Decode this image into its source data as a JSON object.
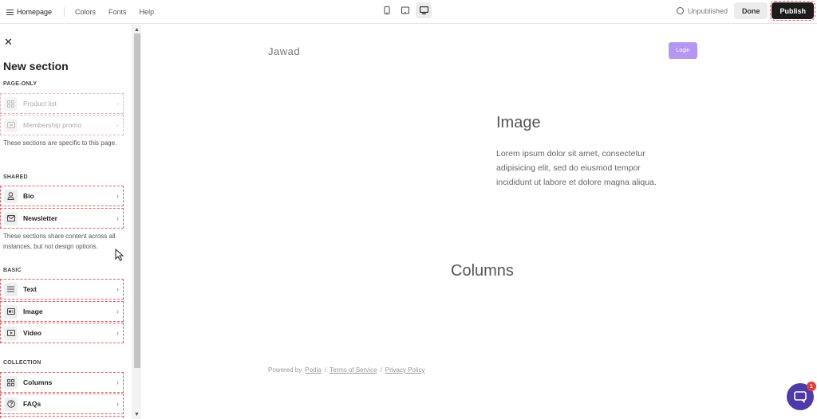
{
  "topbar": {
    "home_label": "Homepage",
    "nav": [
      "Colors",
      "Fonts",
      "Help"
    ],
    "status": "Unpublished",
    "done_label": "Done",
    "publish_label": "Publish"
  },
  "panel": {
    "close_symbol": "✕",
    "title": "New section",
    "groups": {
      "page_only": {
        "label": "PAGE-ONLY",
        "items": [
          {
            "label": "Product list",
            "icon": "grid-icon"
          },
          {
            "label": "Membership promo",
            "icon": "card-icon"
          }
        ],
        "note": "These sections are specific to this page."
      },
      "shared": {
        "label": "SHARED",
        "items": [
          {
            "label": "Bio",
            "icon": "person-icon"
          },
          {
            "label": "Newsletter",
            "icon": "mail-icon"
          }
        ],
        "note": "These sections share content across all instances, but not design options."
      },
      "basic": {
        "label": "BASIC",
        "items": [
          {
            "label": "Text",
            "icon": "text-lines-icon"
          },
          {
            "label": "Image",
            "icon": "image-icon"
          },
          {
            "label": "Video",
            "icon": "video-icon"
          }
        ]
      },
      "collection": {
        "label": "COLLECTION",
        "items": [
          {
            "label": "Columns",
            "icon": "grid-icon"
          },
          {
            "label": "FAQs",
            "icon": "question-icon"
          }
        ]
      }
    }
  },
  "preview": {
    "brand": "Jawad",
    "login_label": "Login",
    "image_title": "Image",
    "image_text": "Lorem ipsum dolor sit amet, consectetur adipisicing elit, sed do eiusmod tempor incididunt ut labore et dolore magna aliqua.",
    "columns_title": "Columns",
    "footer": {
      "powered_by": "Powered by",
      "podia": "Podia",
      "sep": "/",
      "terms": "Terms of Service",
      "privacy": "Privacy Policy"
    }
  },
  "chat": {
    "badge": "1"
  },
  "colors": {
    "accent": "#b597f2",
    "chat": "#4f3aa8",
    "publish": "#1d1d1d",
    "badge": "#e23b3b"
  }
}
